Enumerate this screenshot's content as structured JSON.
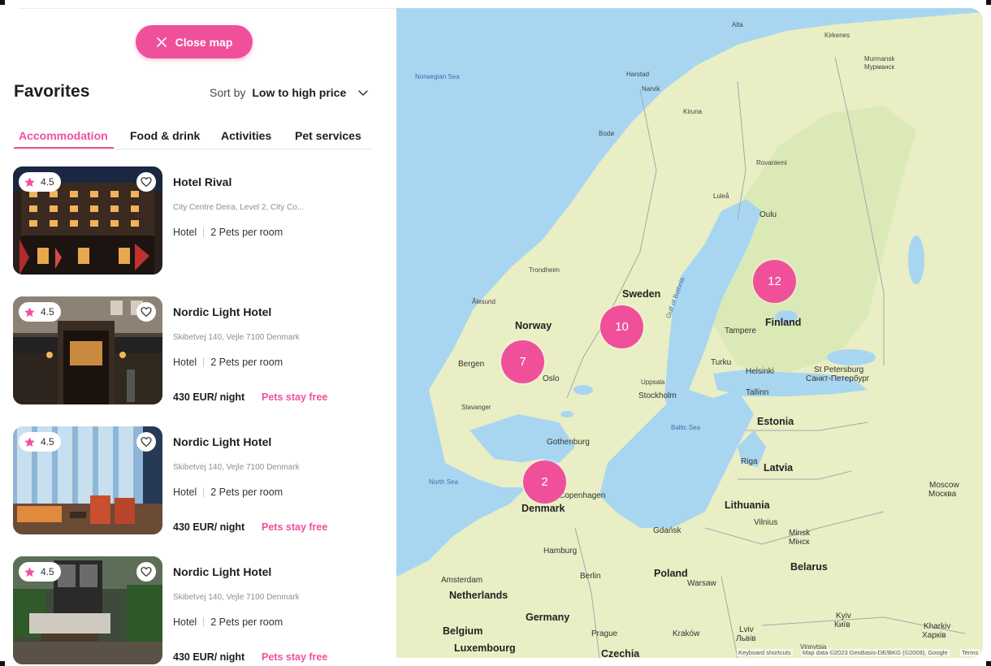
{
  "close_map_label": "Close map",
  "page_title": "Favorites",
  "sort": {
    "label": "Sort by",
    "value": "Low to high price"
  },
  "tabs": [
    "Accommodation",
    "Food & drink",
    "Activities",
    "Pet services"
  ],
  "active_tab": "Accommodation",
  "cards": [
    {
      "rating": "4.5",
      "name": "Hotel Rival",
      "address": "City Centre Deira, Level 2, City Co...",
      "type": "Hotel",
      "pets": "2 Pets per room",
      "price": "",
      "promo": ""
    },
    {
      "rating": "4.5",
      "name": "Nordic Light Hotel",
      "address": "Skibetvej 140, Vejle 7100 Denmark",
      "type": "Hotel",
      "pets": "2 Pets per room",
      "price": "430 EUR/ night",
      "promo": "Pets stay free"
    },
    {
      "rating": "4.5",
      "name": "Nordic Light Hotel",
      "address": "Skibetvej 140, Vejle 7100 Denmark",
      "type": "Hotel",
      "pets": "2 Pets per room",
      "price": "430 EUR/ night",
      "promo": "Pets stay free"
    },
    {
      "rating": "4.5",
      "name": "Nordic Light Hotel",
      "address": "Skibetvej 140, Vejle 7100 Denmark",
      "type": "Hotel",
      "pets": "2 Pets per room",
      "price": "430 EUR/ night",
      "promo": "Pets stay free"
    }
  ],
  "map": {
    "clusters": [
      "7",
      "10",
      "12",
      "2"
    ],
    "countries": [
      "Norway",
      "Sweden",
      "Finland",
      "Estonia",
      "Latvia",
      "Lithuania",
      "Denmark",
      "Poland",
      "Belarus",
      "Germany",
      "Netherlands",
      "Belgium",
      "Luxembourg",
      "Czechia"
    ],
    "cities": [
      "Alta",
      "Kirkenes",
      "Murmansk",
      "Мурманск",
      "Harstad",
      "Narvik",
      "Kiruna",
      "Bodø",
      "Rovaniemi",
      "Luleå",
      "Oulu",
      "Trondheim",
      "Ålesund",
      "Bergen",
      "Oslo",
      "Stavanger",
      "Tampere",
      "Turku",
      "Helsinki",
      "Tallinn",
      "St Petersburg",
      "Санкт-Петербург",
      "Uppsala",
      "Stockholm",
      "Gothenburg",
      "Riga",
      "Copenhagen",
      "Gdańsk",
      "Vilnius",
      "Minsk",
      "Мінск",
      "Hamburg",
      "Berlin",
      "Warsaw",
      "Amsterdam",
      "Prague",
      "Kraków",
      "Lviv",
      "Львів",
      "Kyiv",
      "Київ",
      "Kharkiv",
      "Харків",
      "Moscow",
      "Москва",
      "Vinnytsia"
    ],
    "seas": [
      "Norwegian Sea",
      "Gulf of Bothnia",
      "Baltic Sea",
      "North Sea"
    ],
    "attribution": {
      "shortcuts": "Keyboard shortcuts",
      "data": "Map data ©2023 GeoBasis-DE/BKG (©2009), Google",
      "terms": "Terms"
    }
  },
  "colors": {
    "accent": "#f0509a",
    "water": "#a8d6f0",
    "land": "#e9eec4",
    "forest": "#d9e8b5"
  }
}
